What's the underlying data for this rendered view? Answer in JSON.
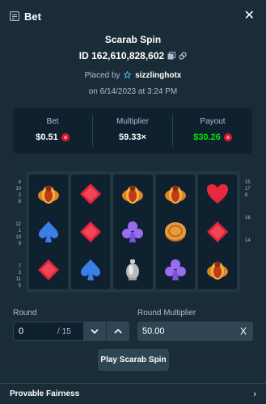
{
  "header": {
    "title": "Bet",
    "icon": "bet-slip-icon",
    "close_icon": "close-icon"
  },
  "game": {
    "name": "Scarab Spin",
    "id_text": "ID 162,610,828,602",
    "placed_prefix": "Placed by",
    "username": "sizzlinghotx",
    "date_text": "on 6/14/2023 at 3:24 PM"
  },
  "stats": {
    "bet_label": "Bet",
    "bet_value": "$0.51",
    "multiplier_label": "Multiplier",
    "multiplier_value": "59.33×",
    "payout_label": "Payout",
    "payout_value": "$30.26",
    "currency_icon": "coin-icon",
    "colors": {
      "payout": "#00e701",
      "coin": "#e3162c"
    }
  },
  "paylines": {
    "left": [
      [
        "4",
        "10",
        "2",
        "8"
      ],
      [
        "12",
        "1",
        "13",
        "9"
      ],
      [
        "7",
        "3",
        "11",
        "5"
      ]
    ],
    "right": [
      [
        "15",
        "17",
        "6"
      ],
      [
        "16"
      ],
      [
        "14"
      ]
    ]
  },
  "reels": [
    [
      "scarab",
      "spade",
      "diamond"
    ],
    [
      "diamond",
      "diamond",
      "spade"
    ],
    [
      "scarab",
      "club",
      "urn"
    ],
    [
      "scarab",
      "coin",
      "club"
    ],
    [
      "heart",
      "diamond",
      "scarab"
    ]
  ],
  "round": {
    "label": "Round",
    "value": "0",
    "total": "/ 15",
    "down_icon": "chevron-down-icon",
    "up_icon": "chevron-up-icon"
  },
  "round_multiplier": {
    "label": "Round Multiplier",
    "value": "50.00",
    "clear_icon": "clear-x-icon"
  },
  "play_button": "Play Scarab Spin",
  "footer": {
    "label": "Provable Fairness",
    "icon": "chevron-right-icon"
  }
}
